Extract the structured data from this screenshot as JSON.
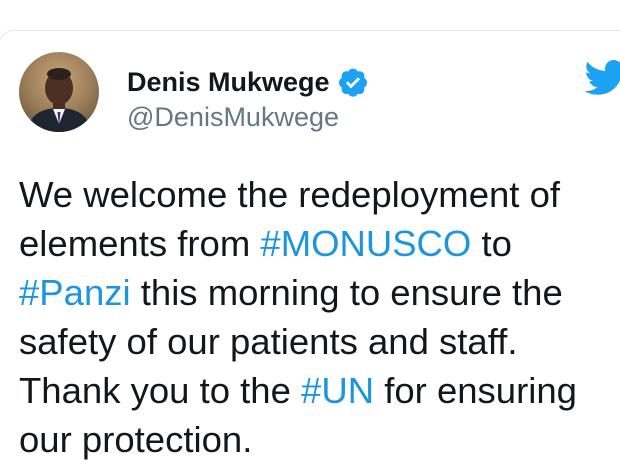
{
  "author": {
    "name": "Denis Mukwege",
    "handle": "@DenisMukwege",
    "verified": true,
    "avatar_icon": "profile-photo"
  },
  "brand": {
    "icon": "twitter-bird-icon",
    "accent_color": "#1da1f2",
    "hashtag_color": "#1b95e0"
  },
  "tweet": {
    "lines": [
      [
        "We welcome the redeployment of"
      ],
      [
        "elements from ",
        "#MONUSCO",
        " to"
      ],
      [
        "#Panzi",
        " this morning to ensure the"
      ],
      [
        "safety of our patients and staff."
      ],
      [
        "Thank you to the ",
        "#UN",
        " for ensuring"
      ],
      [
        "our protection."
      ]
    ]
  }
}
